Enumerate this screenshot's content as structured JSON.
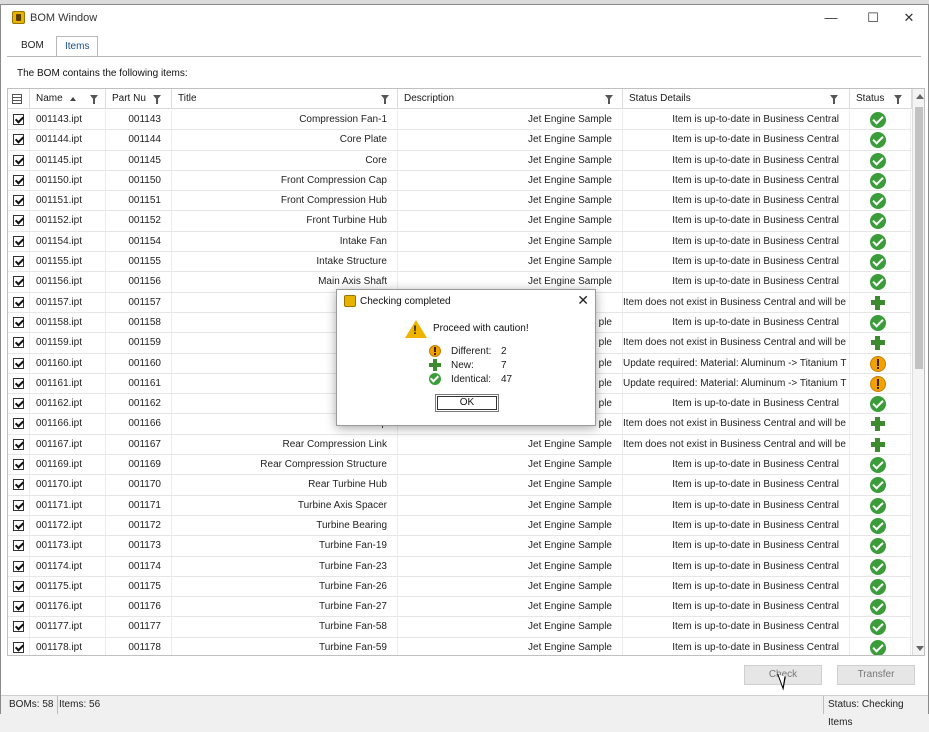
{
  "window": {
    "title": "BOM Window",
    "minimize": "—",
    "maximize": "☐",
    "close": "✕"
  },
  "tabs": [
    {
      "label": "BOM"
    },
    {
      "label": "Items"
    }
  ],
  "content_label": "The BOM contains the following items:",
  "columns": {
    "name": "Name",
    "part": "Part Nu",
    "title": "Title",
    "description": "Description",
    "status_details": "Status Details",
    "status": "Status"
  },
  "rows": [
    {
      "name": "001143.ipt",
      "part": "001143",
      "title": "Compression Fan-1",
      "description": "Jet Engine Sample",
      "details": "Item is up-to-date in Business Central",
      "status": "ok"
    },
    {
      "name": "001144.ipt",
      "part": "001144",
      "title": "Core Plate",
      "description": "Jet Engine Sample",
      "details": "Item is up-to-date in Business Central",
      "status": "ok"
    },
    {
      "name": "001145.ipt",
      "part": "001145",
      "title": "Core",
      "description": "Jet Engine Sample",
      "details": "Item is up-to-date in Business Central",
      "status": "ok"
    },
    {
      "name": "001150.ipt",
      "part": "001150",
      "title": "Front Compression Cap",
      "description": "Jet Engine Sample",
      "details": "Item is up-to-date in Business Central",
      "status": "ok"
    },
    {
      "name": "001151.ipt",
      "part": "001151",
      "title": "Front Compression Hub",
      "description": "Jet Engine Sample",
      "details": "Item is up-to-date in Business Central",
      "status": "ok"
    },
    {
      "name": "001152.ipt",
      "part": "001152",
      "title": "Front Turbine Hub",
      "description": "Jet Engine Sample",
      "details": "Item is up-to-date in Business Central",
      "status": "ok"
    },
    {
      "name": "001154.ipt",
      "part": "001154",
      "title": "Intake Fan",
      "description": "Jet Engine Sample",
      "details": "Item is up-to-date in Business Central",
      "status": "ok"
    },
    {
      "name": "001155.ipt",
      "part": "001155",
      "title": "Intake Structure",
      "description": "Jet Engine Sample",
      "details": "Item is up-to-date in Business Central",
      "status": "ok"
    },
    {
      "name": "001156.ipt",
      "part": "001156",
      "title": "Main Axis Shaft",
      "description": "Jet Engine Sample",
      "details": "Item is up-to-date in Business Central",
      "status": "ok"
    },
    {
      "name": "001157.ipt",
      "part": "001157",
      "title": "Mi",
      "description": "",
      "details": "Item does not exist in Business Central and will be c",
      "status": "new"
    },
    {
      "name": "001158.ipt",
      "part": "001158",
      "title": "Mid Comp",
      "description": "ple",
      "details": "Item is up-to-date in Business Central",
      "status": "ok"
    },
    {
      "name": "001159.ipt",
      "part": "001159",
      "title": "Mid Comp",
      "description": "ple",
      "details": "Item does not exist in Business Central and will be c",
      "status": "new"
    },
    {
      "name": "001160.ipt",
      "part": "001160",
      "title": "Mid Comp",
      "description": "ple",
      "details": "Update required: Material: Aluminum -> Titanium T",
      "status": "warn"
    },
    {
      "name": "001161.ipt",
      "part": "001161",
      "title": "Mid Compr",
      "description": "ple",
      "details": "Update required: Material: Aluminum -> Titanium T",
      "status": "warn"
    },
    {
      "name": "001162.ipt",
      "part": "001162",
      "title": "",
      "description": "ple",
      "details": "Item is up-to-date in Business Central",
      "status": "ok"
    },
    {
      "name": "001166.ipt",
      "part": "001166",
      "title": "Rear Comp",
      "description": "ple",
      "details": "Item does not exist in Business Central and will be c",
      "status": "new"
    },
    {
      "name": "001167.ipt",
      "part": "001167",
      "title": "Rear Compression Link",
      "description": "Jet Engine Sample",
      "details": "Item does not exist in Business Central and will be c",
      "status": "new"
    },
    {
      "name": "001169.ipt",
      "part": "001169",
      "title": "Rear Compression Structure",
      "description": "Jet Engine Sample",
      "details": "Item is up-to-date in Business Central",
      "status": "ok"
    },
    {
      "name": "001170.ipt",
      "part": "001170",
      "title": "Rear Turbine Hub",
      "description": "Jet Engine Sample",
      "details": "Item is up-to-date in Business Central",
      "status": "ok"
    },
    {
      "name": "001171.ipt",
      "part": "001171",
      "title": "Turbine Axis Spacer",
      "description": "Jet Engine Sample",
      "details": "Item is up-to-date in Business Central",
      "status": "ok"
    },
    {
      "name": "001172.ipt",
      "part": "001172",
      "title": "Turbine Bearing",
      "description": "Jet Engine Sample",
      "details": "Item is up-to-date in Business Central",
      "status": "ok"
    },
    {
      "name": "001173.ipt",
      "part": "001173",
      "title": "Turbine Fan-19",
      "description": "Jet Engine Sample",
      "details": "Item is up-to-date in Business Central",
      "status": "ok"
    },
    {
      "name": "001174.ipt",
      "part": "001174",
      "title": "Turbine Fan-23",
      "description": "Jet Engine Sample",
      "details": "Item is up-to-date in Business Central",
      "status": "ok"
    },
    {
      "name": "001175.ipt",
      "part": "001175",
      "title": "Turbine Fan-26",
      "description": "Jet Engine Sample",
      "details": "Item is up-to-date in Business Central",
      "status": "ok"
    },
    {
      "name": "001176.ipt",
      "part": "001176",
      "title": "Turbine Fan-27",
      "description": "Jet Engine Sample",
      "details": "Item is up-to-date in Business Central",
      "status": "ok"
    },
    {
      "name": "001177.ipt",
      "part": "001177",
      "title": "Turbine Fan-58",
      "description": "Jet Engine Sample",
      "details": "Item is up-to-date in Business Central",
      "status": "ok"
    },
    {
      "name": "001178.ipt",
      "part": "001178",
      "title": "Turbine Fan-59",
      "description": "Jet Engine Sample",
      "details": "Item is up-to-date in Business Central",
      "status": "ok"
    }
  ],
  "buttons": {
    "check": "Check",
    "transfer": "Transfer"
  },
  "statusbar": {
    "boms": "BOMs: 58",
    "items": "Items: 56",
    "status": "Status: Checking Items"
  },
  "dialog": {
    "title": "Checking completed",
    "close": "✕",
    "message": "Proceed with caution!",
    "summary": [
      {
        "label": "Different:",
        "value": "2",
        "icon": "warn"
      },
      {
        "label": "New:",
        "value": "7",
        "icon": "new"
      },
      {
        "label": "Identical:",
        "value": "47",
        "icon": "ok"
      }
    ],
    "ok": "OK"
  },
  "colors": {
    "ok": "#3a9d3a",
    "new": "#3d8b2f",
    "warn": "#f2a100",
    "tab_active_text": "#1a4e8a"
  },
  "icons": {
    "ok": "green-check-circle-icon",
    "new": "green-plus-icon",
    "warn": "orange-exclamation-circle-icon"
  }
}
